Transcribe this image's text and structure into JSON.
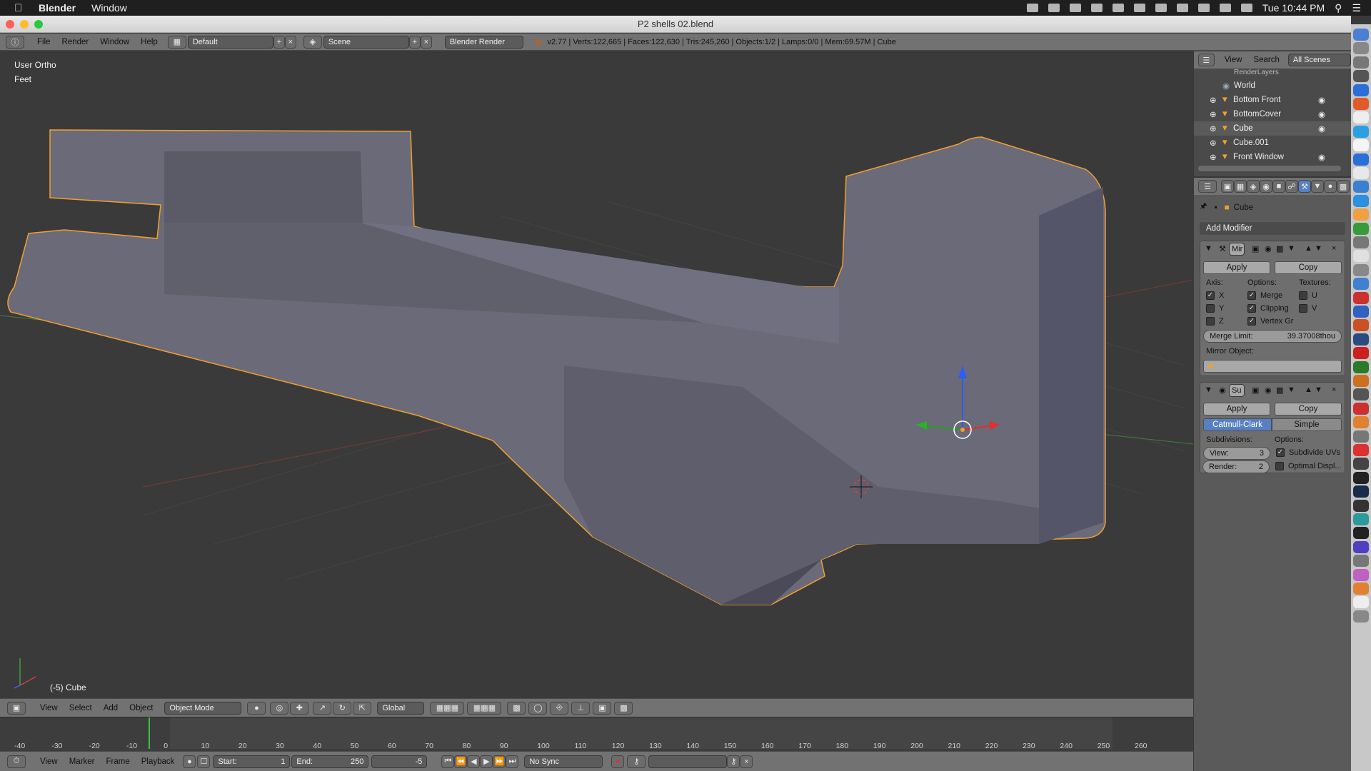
{
  "menubar": {
    "app": "Blender",
    "menu": "Window",
    "clock": "Tue 10:44 PM"
  },
  "window": {
    "title": "P2 shells 02.blend"
  },
  "top_header": {
    "menus": [
      "File",
      "Render",
      "Window",
      "Help"
    ],
    "layout": "Default",
    "scene": "Scene",
    "engine": "Blender Render",
    "stats": "v2.77 | Verts:122,665 | Faces:122,630 | Tris:245,260 | Objects:1/2 | Lamps:0/0 | Mem:69.57M | Cube"
  },
  "viewport": {
    "view_label": "User Ortho",
    "units_label": "Feet",
    "object_label": "(-5) Cube"
  },
  "view3d_header": {
    "menus": [
      "View",
      "Select",
      "Add",
      "Object"
    ],
    "mode": "Object Mode",
    "orientation": "Global"
  },
  "timeline": {
    "ticks": [
      "-40",
      "-30",
      "-20",
      "-10",
      "0",
      "10",
      "20",
      "30",
      "40",
      "50",
      "60",
      "70",
      "80",
      "90",
      "100",
      "110",
      "120",
      "130",
      "140",
      "150",
      "160",
      "170",
      "180",
      "190",
      "200",
      "210",
      "220",
      "230",
      "240",
      "250",
      "260"
    ],
    "menus": [
      "View",
      "Marker",
      "Frame",
      "Playback"
    ],
    "start_label": "Start:",
    "start": "1",
    "end_label": "End:",
    "end": "250",
    "current": "-5",
    "sync": "No Sync"
  },
  "outliner": {
    "menus": [
      "View",
      "Search"
    ],
    "filter": "All Scenes",
    "items": [
      "RenderLayers",
      "World",
      "Bottom Front",
      "BottomCover",
      "Cube",
      "Cube.001",
      "Front Window"
    ]
  },
  "properties": {
    "context": "Cube",
    "add_modifier": "Add Modifier",
    "mirror": {
      "name": "Mir",
      "apply": "Apply",
      "copy": "Copy",
      "axis_label": "Axis:",
      "options_label": "Options:",
      "textures_label": "Textures:",
      "axes": [
        "X",
        "Y",
        "Z"
      ],
      "options": [
        "Merge",
        "Clipping",
        "Vertex Gr"
      ],
      "textures": [
        "U",
        "V"
      ],
      "merge_limit_label": "Merge Limit:",
      "merge_limit": "39.37008thou",
      "mirror_object_label": "Mirror Object:"
    },
    "subsurf": {
      "name": "Su",
      "apply": "Apply",
      "copy": "Copy",
      "tab_catmull": "Catmull-Clark",
      "tab_simple": "Simple",
      "subdivisions_label": "Subdivisions:",
      "options_label": "Options:",
      "view_label": "View:",
      "view_value": "3",
      "render_label": "Render:",
      "render_value": "2",
      "opt1": "Subdivide UVs",
      "opt2": "Optimal Displ..."
    }
  },
  "colors": {
    "accent_blue": "#5680c2",
    "selection_orange": "#f0a030",
    "viewport_bg": "#3a3a3a"
  }
}
